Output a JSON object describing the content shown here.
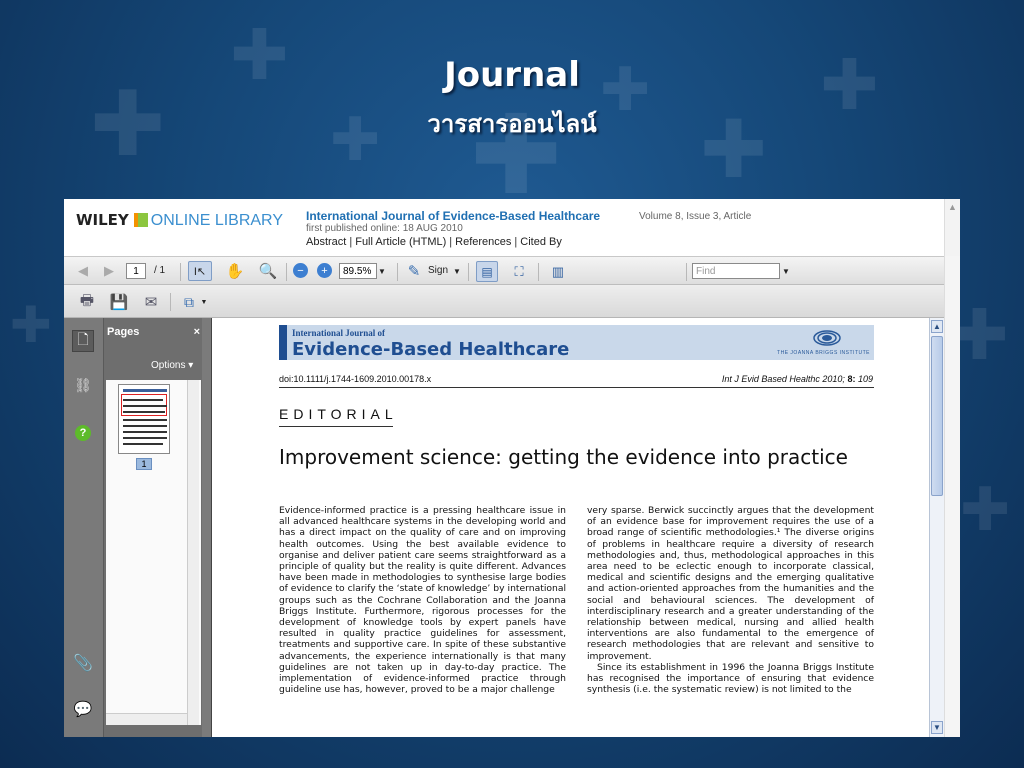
{
  "slide": {
    "title": "Journal",
    "subtitle": "วารสารออนไลน์"
  },
  "wiley_header": {
    "logo_wiley": "WILEY",
    "logo_online": "ONLINE LIBRARY",
    "journal_title": "International Journal of Evidence-Based Healthcare",
    "volume_info": "Volume 8, Issue 3, Article",
    "published": "first published online: 18 AUG 2010",
    "links": [
      "Abstract",
      "Full Article (HTML)",
      "References",
      "Cited By"
    ]
  },
  "toolbar": {
    "page_current": "1",
    "page_total": "/ 1",
    "zoom": "89.5%",
    "sign_label": "Sign",
    "find_placeholder": "Find"
  },
  "pages_panel": {
    "title": "Pages",
    "close": "×",
    "options": "Options",
    "thumb_page_number": "1"
  },
  "document": {
    "banner_small": "International Journal of",
    "banner_big": "Evidence-Based Healthcare",
    "banner_jbi": "THE JOANNA BRIGGS INSTITUTE",
    "doi": "doi:10.1111/j.1744-1609.2010.00178.x",
    "cite_prefix": "Int J Evid Based Healthc",
    "cite_year": "2010;",
    "cite_vol": "8:",
    "cite_page": "109",
    "section": "EDITORIAL",
    "title": "Improvement science: getting the evidence into practice",
    "col1": "Evidence-informed practice is a pressing healthcare issue in all advanced healthcare systems in the developing world and has a direct impact on the quality of care and on improving health outcomes. Using the best available evidence to organise and deliver patient care seems straightforward as a principle of quality but the reality is quite different. Advances have been made in methodologies to synthesise large bodies of evidence to clarify the ‘state of knowledge’ by international groups such as the Cochrane Collaboration and the Joanna Briggs Institute. Furthermore, rigorous processes for the development of knowledge tools by expert panels have resulted in quality practice guidelines for assessment, treatments and supportive care. In spite of these substantive advancements, the experience internationally is that many guidelines are not taken up in day-to-day practice. The implementation of evidence-informed practice through guideline use has, however, proved to be a major challenge",
    "col2_p1": "very sparse. Berwick succinctly argues that the development of an evidence base for improvement requires the use of a broad range of scientific methodologies.¹ The diverse origins of problems in healthcare require a diversity of research methodologies and, thus, methodological approaches in this area need to be eclectic enough to incorporate classical, medical and scientific designs and the emerging qualitative and action-oriented approaches from the humanities and the social and behavioural sciences. The development of interdisciplinary research and a greater understanding of the relationship between medical, nursing and allied health interventions are also fundamental to the emergence of research methodologies that are relevant and sensitive to improvement.",
    "col2_p2": "Since its establishment in 1996 the Joanna Briggs Institute has recognised the importance of ensuring that evidence synthesis (i.e. the systematic review) is not limited to the"
  },
  "icons": {
    "colors": {
      "accent_blue": "#1f6fb2",
      "banner_blue": "#1f4e91",
      "panel_grey": "#6e6e6e"
    }
  }
}
